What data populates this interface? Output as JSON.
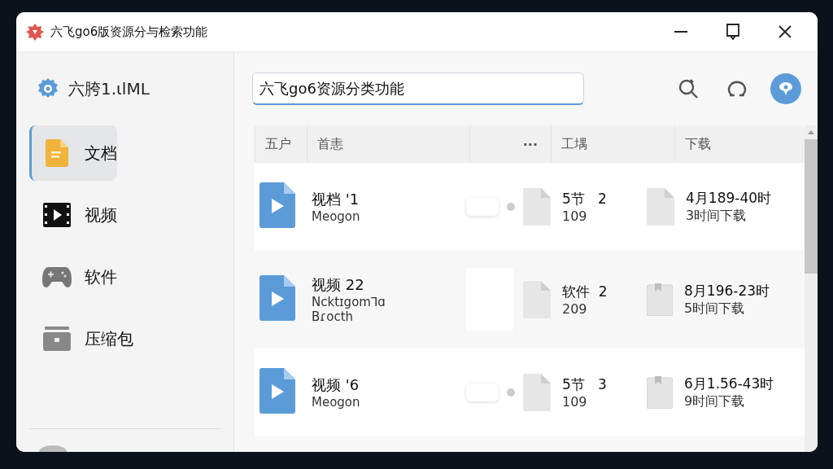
{
  "window": {
    "title": "六飞go6版资源分与检索功能"
  },
  "sidebar": {
    "brand": "六胯1.ιlML",
    "items": [
      {
        "label": "文档",
        "kind": "document",
        "selected": true
      },
      {
        "label": "视频",
        "kind": "video",
        "selected": false
      },
      {
        "label": "软件",
        "kind": "gamepad",
        "selected": false
      },
      {
        "label": "压缩包",
        "kind": "archive",
        "selected": false
      }
    ]
  },
  "search": {
    "value": "六飞go6资源分类功能"
  },
  "table": {
    "columns": [
      "五户",
      "首恚",
      "···",
      "工堣",
      "下载"
    ],
    "rows": [
      {
        "name": "视档 '1",
        "sub": [
          "Meogon"
        ],
        "kind": "toggle",
        "size": "5节   2",
        "count": "109",
        "date": "4月189-40时",
        "note": "3时间下载"
      },
      {
        "name": "视频 22",
        "sub": [
          "Ncktɪgom⅂ɑ",
          "Bɾocth"
        ],
        "kind": "blank",
        "size": "软件  2",
        "count": "209",
        "date": "8月196-23时",
        "note": "5时间下载"
      },
      {
        "name": "视频 '6",
        "sub": [
          "Meogon"
        ],
        "kind": "toggle",
        "size": "5节   3",
        "count": "109",
        "date": "6月1.56-43时",
        "note": "9时间下载"
      }
    ]
  }
}
